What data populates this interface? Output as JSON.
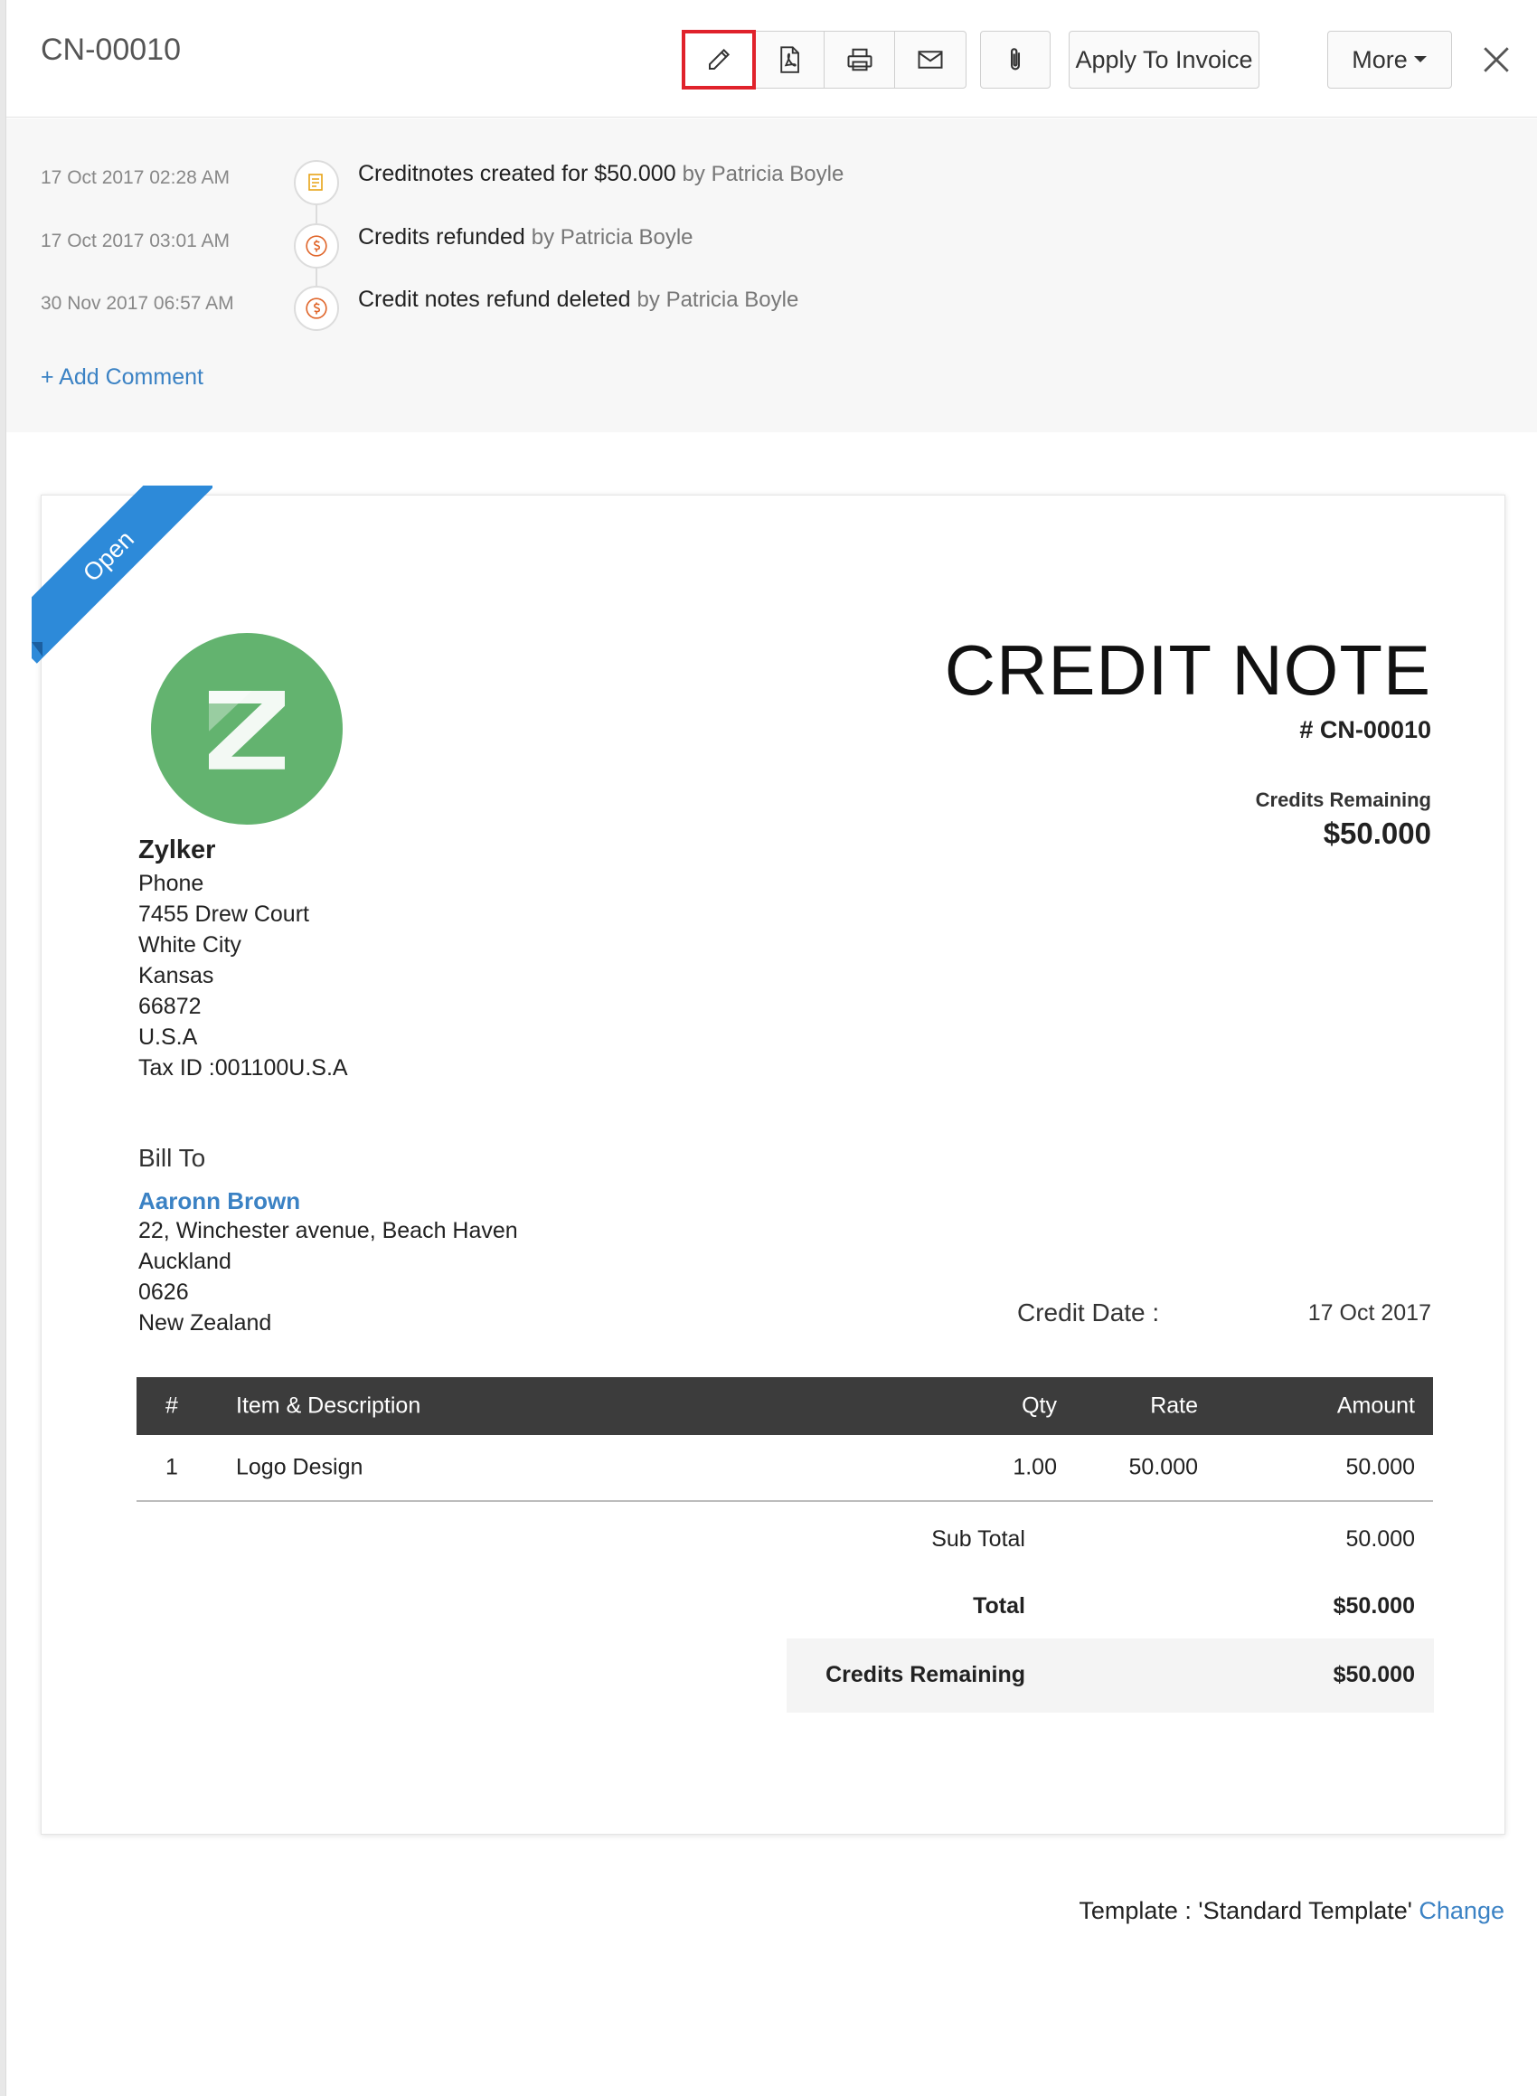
{
  "header": {
    "doc_title": "CN-00010",
    "apply_to_invoice_label": "Apply To Invoice",
    "more_label": "More"
  },
  "activity": [
    {
      "time": "17 Oct 2017 02:28 AM",
      "text": "Creditnotes created for $50.000",
      "by": "by Patricia Boyle",
      "icon": "note-icon",
      "icon_color": "#e8a317"
    },
    {
      "time": "17 Oct 2017 03:01 AM",
      "text": "Credits refunded",
      "by": "by Patricia Boyle",
      "icon": "dollar-icon",
      "icon_color": "#e0662b"
    },
    {
      "time": "30 Nov 2017 06:57 AM",
      "text": "Credit notes refund deleted",
      "by": "by Patricia Boyle",
      "icon": "dollar-icon",
      "icon_color": "#e0662b"
    }
  ],
  "add_comment_label": "+ Add Comment",
  "document": {
    "status_ribbon": "Open",
    "title": "CREDIT NOTE",
    "number": "# CN-00010",
    "credits_remaining_label": "Credits Remaining",
    "credits_remaining_value": "$50.000",
    "logo_letter": "Z",
    "org": {
      "name": "Zylker",
      "lines": [
        "Phone",
        "7455 Drew Court",
        "White City",
        "Kansas",
        "66872",
        "U.S.A",
        "Tax ID :001100U.S.A"
      ]
    },
    "bill_to_label": "Bill To",
    "customer": {
      "name": "Aaronn Brown",
      "lines": [
        "22, Winchester avenue, Beach Haven",
        "Auckland",
        "0626",
        "New Zealand"
      ]
    },
    "credit_date_label": "Credit Date :",
    "credit_date_value": "17 Oct 2017",
    "table": {
      "headers": [
        "#",
        "Item & Description",
        "Qty",
        "Rate",
        "Amount"
      ],
      "rows": [
        [
          "1",
          "Logo Design",
          "1.00",
          "50.000",
          "50.000"
        ]
      ]
    },
    "summary": {
      "sub_total_label": "Sub Total",
      "sub_total_value": "50.000",
      "total_label": "Total",
      "total_value": "$50.000",
      "credits_remaining_label": "Credits Remaining",
      "credits_remaining_value": "$50.000"
    }
  },
  "template": {
    "prefix": "Template : 'Standard Template'",
    "change_label": "Change"
  },
  "colors": {
    "accent": "#3b82c4",
    "ribbon": "#2d8ad9",
    "highlight": "#e0222b",
    "logo_bg": "#63b36f",
    "table_header": "#3c3c3c"
  }
}
